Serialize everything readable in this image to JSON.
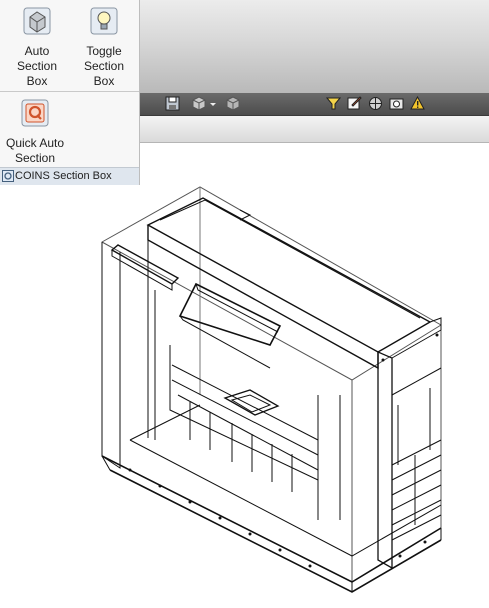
{
  "panel": {
    "title": "COINS Section Box",
    "tools": [
      {
        "label": "Auto\nSection Box",
        "icon": "cube-icon"
      },
      {
        "label": "Toggle\nSection Box",
        "icon": "lightbulb-cube-icon"
      },
      {
        "label": "Quick Auto\nSection",
        "icon": "quick-section-icon"
      }
    ]
  },
  "toolbar": {
    "icons": [
      "save-icon",
      "cube-dropdown-icon",
      "cube-icon",
      "filter-icon",
      "section-edit-icon",
      "sphere-icon",
      "camera-icon",
      "warning-icon"
    ]
  }
}
